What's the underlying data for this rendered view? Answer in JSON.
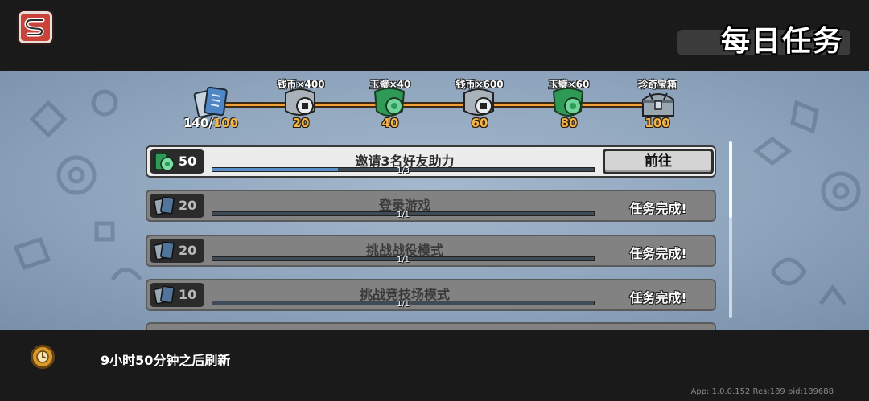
{
  "header": {
    "title": "每日任务",
    "logo_icon": "red-s-logo-icon"
  },
  "progress": {
    "current": "140/",
    "max": "100",
    "milestones": [
      {
        "label": "钱币×400",
        "value": "20",
        "icon": "silver-coin-chest-icon"
      },
      {
        "label": "玉璧×40",
        "value": "40",
        "icon": "green-jade-shield-icon"
      },
      {
        "label": "钱币×600",
        "value": "60",
        "icon": "silver-coin-chest-icon"
      },
      {
        "label": "玉璧×60",
        "value": "80",
        "icon": "green-jade-shield-icon"
      },
      {
        "label": "珍奇宝箱",
        "value": "100",
        "icon": "treasure-chest-icon"
      }
    ]
  },
  "tasks": [
    {
      "reward": "50",
      "reward_icon": "jade-icon",
      "title": "邀请3名好友助力",
      "progress_text": "1/3",
      "progress": 0.33,
      "action": "前往",
      "status": "active"
    },
    {
      "reward": "20",
      "reward_icon": "card-book-icon",
      "title": "登录游戏",
      "progress_text": "1/1",
      "progress": 1.0,
      "action": "任务完成!",
      "status": "done"
    },
    {
      "reward": "20",
      "reward_icon": "card-book-icon",
      "title": "挑战战役模式",
      "progress_text": "1/1",
      "progress": 1.0,
      "action": "任务完成!",
      "status": "done"
    },
    {
      "reward": "10",
      "reward_icon": "card-book-icon",
      "title": "挑战竞技场模式",
      "progress_text": "1/1",
      "progress": 1.0,
      "action": "任务完成!",
      "status": "done"
    }
  ],
  "footer": {
    "refresh_text": "9小时50分钟之后刷新",
    "app_info": "App: 1.0.0.152 Res:189 pid:189688"
  },
  "colors": {
    "accent_orange": "#f3b54a",
    "progress_blue": "#5b8fc8",
    "panel_blue": "#8ea5bd"
  }
}
